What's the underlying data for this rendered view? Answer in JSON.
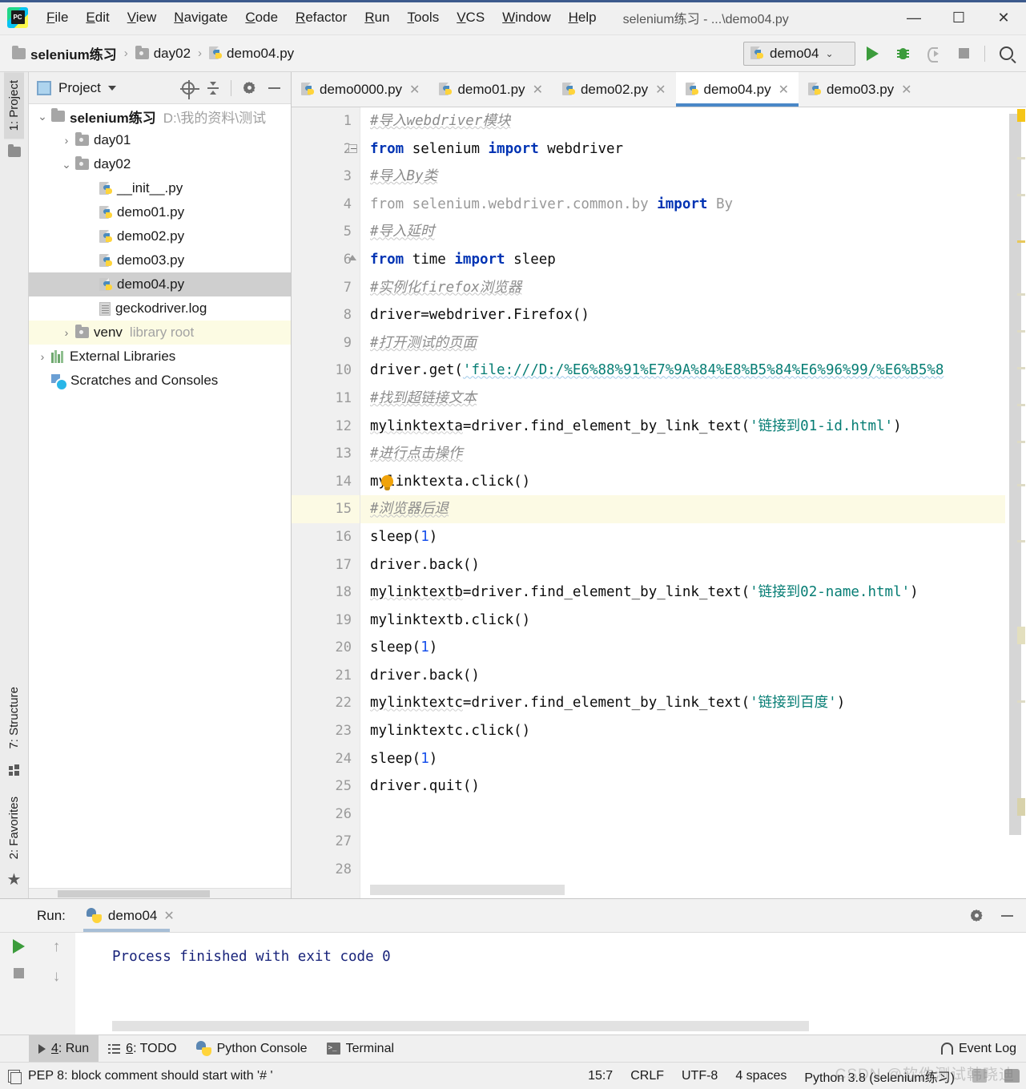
{
  "window": {
    "title": "selenium练习 - ...\\demo04.py",
    "logo_text": "PC",
    "minimize": "—",
    "maximize": "☐",
    "close": "✕"
  },
  "menu": [
    {
      "label": "File"
    },
    {
      "label": "Edit"
    },
    {
      "label": "View"
    },
    {
      "label": "Navigate"
    },
    {
      "label": "Code"
    },
    {
      "label": "Refactor"
    },
    {
      "label": "Run"
    },
    {
      "label": "Tools"
    },
    {
      "label": "VCS"
    },
    {
      "label": "Window"
    },
    {
      "label": "Help"
    }
  ],
  "breadcrumb": [
    {
      "label": "selenium练习",
      "icon": "folder-icon"
    },
    {
      "label": "day02",
      "icon": "folder-icon"
    },
    {
      "label": "demo04.py",
      "icon": "python-file-icon"
    }
  ],
  "toolbar": {
    "run_config": "demo04",
    "dropdown_caret": "⌄",
    "run_button": "run-icon",
    "debug_button": "debug-icon",
    "coverage_button": "run-with-coverage-icon",
    "stop_button": "stop-icon",
    "search_button": "search-everywhere-icon"
  },
  "rail": {
    "left_top": "1: Project",
    "left_bottom_structure": "7: Structure",
    "left_bottom_favorites": "2: Favorites"
  },
  "project_panel": {
    "title": "Project",
    "tools": [
      "select-opened-file-icon",
      "collapse-all-icon",
      "settings-icon",
      "hide-icon"
    ],
    "tree": [
      {
        "indent": 0,
        "arrow": "⌄",
        "icon": "folder-icon",
        "label": "selenium练习",
        "bold": true,
        "path": "D:\\我的资料\\测试",
        "state": "normal"
      },
      {
        "indent": 1,
        "arrow": "›",
        "icon": "folder-icon",
        "label": "day01",
        "bold": false,
        "path": "",
        "state": "normal"
      },
      {
        "indent": 1,
        "arrow": "⌄",
        "icon": "folder-icon",
        "label": "day02",
        "bold": false,
        "path": "",
        "state": "normal"
      },
      {
        "indent": 2,
        "arrow": "",
        "icon": "python-file-icon",
        "label": "__init__.py",
        "bold": false,
        "path": "",
        "state": "normal"
      },
      {
        "indent": 2,
        "arrow": "",
        "icon": "python-file-icon",
        "label": "demo01.py",
        "bold": false,
        "path": "",
        "state": "normal"
      },
      {
        "indent": 2,
        "arrow": "",
        "icon": "python-file-icon",
        "label": "demo02.py",
        "bold": false,
        "path": "",
        "state": "normal"
      },
      {
        "indent": 2,
        "arrow": "",
        "icon": "python-file-icon",
        "label": "demo03.py",
        "bold": false,
        "path": "",
        "state": "normal"
      },
      {
        "indent": 2,
        "arrow": "",
        "icon": "python-file-icon",
        "label": "demo04.py",
        "bold": false,
        "path": "",
        "state": "selected"
      },
      {
        "indent": 2,
        "arrow": "",
        "icon": "log-file-icon",
        "label": "geckodriver.log",
        "bold": false,
        "path": "",
        "state": "normal"
      },
      {
        "indent": 1,
        "arrow": "›",
        "icon": "folder-icon",
        "label": "venv",
        "bold": false,
        "path": "library root",
        "state": "highlight"
      },
      {
        "indent": 0,
        "arrow": "›",
        "icon": "external-libraries-icon",
        "label": "External Libraries",
        "bold": false,
        "path": "",
        "state": "normal"
      },
      {
        "indent": 0,
        "arrow": "",
        "icon": "scratches-icon",
        "label": "Scratches and Consoles",
        "bold": false,
        "path": "",
        "state": "normal"
      }
    ]
  },
  "editor": {
    "tabs": [
      {
        "label": "demo0000.py",
        "active": false,
        "close": "✕"
      },
      {
        "label": "demo01.py",
        "active": false,
        "close": "✕"
      },
      {
        "label": "demo02.py",
        "active": false,
        "close": "✕"
      },
      {
        "label": "demo04.py",
        "active": true,
        "close": "✕"
      },
      {
        "label": "demo03.py",
        "active": false,
        "close": "✕"
      }
    ],
    "current_line": 15,
    "lines": [
      {
        "n": 1,
        "tokens": [
          {
            "t": "#导入webdriver模块",
            "c": "cmt squig"
          }
        ]
      },
      {
        "n": 2,
        "tokens": [
          {
            "t": "from",
            "c": "kw"
          },
          {
            "t": " selenium ",
            "c": "txt"
          },
          {
            "t": "import",
            "c": "kw"
          },
          {
            "t": " webdriver",
            "c": "txt"
          }
        ],
        "fold": "open"
      },
      {
        "n": 3,
        "tokens": [
          {
            "t": "#导入By类",
            "c": "cmt squig"
          }
        ]
      },
      {
        "n": 4,
        "tokens": [
          {
            "t": "from selenium.webdriver.common.by ",
            "c": "gry"
          },
          {
            "t": "import",
            "c": "kw"
          },
          {
            "t": " By",
            "c": "gry"
          }
        ]
      },
      {
        "n": 5,
        "tokens": [
          {
            "t": "#导入延时",
            "c": "cmt squig"
          }
        ]
      },
      {
        "n": 6,
        "tokens": [
          {
            "t": "from",
            "c": "kw"
          },
          {
            "t": " time ",
            "c": "txt"
          },
          {
            "t": "import",
            "c": "kw"
          },
          {
            "t": " sleep",
            "c": "txt"
          }
        ],
        "fold": "close"
      },
      {
        "n": 7,
        "tokens": [
          {
            "t": "#实例化firefox浏览器",
            "c": "cmt squig"
          }
        ]
      },
      {
        "n": 8,
        "tokens": [
          {
            "t": "driver=webdriver.Firefox()",
            "c": "txt"
          }
        ]
      },
      {
        "n": 9,
        "tokens": [
          {
            "t": "#打开测试的页面",
            "c": "cmt squig"
          }
        ]
      },
      {
        "n": 10,
        "tokens": [
          {
            "t": "driver.get(",
            "c": "txt"
          },
          {
            "t": "'file:///D:/%E6%88%91%E7%9A%84%E8%B5%84%E6%96%99/%E6%B5%8",
            "c": "str squig-b"
          }
        ]
      },
      {
        "n": 11,
        "tokens": [
          {
            "t": "#找到超链接文本",
            "c": "cmt squig"
          }
        ]
      },
      {
        "n": 12,
        "tokens": [
          {
            "t": "mylinktexta",
            "c": "txt squig-g"
          },
          {
            "t": "=driver.find_element_by_link_text(",
            "c": "txt"
          },
          {
            "t": "'链接到01-id.html'",
            "c": "str"
          },
          {
            "t": ")",
            "c": "txt"
          }
        ]
      },
      {
        "n": 13,
        "tokens": [
          {
            "t": "#进行点击操作",
            "c": "cmt squig"
          }
        ]
      },
      {
        "n": 14,
        "tokens": [
          {
            "t": "mylinktexta.click()",
            "c": "txt"
          }
        ],
        "bulb": true
      },
      {
        "n": 15,
        "tokens": [
          {
            "t": "#浏览器后退",
            "c": "cmt squig"
          }
        ]
      },
      {
        "n": 16,
        "tokens": [
          {
            "t": "sleep(",
            "c": "txt"
          },
          {
            "t": "1",
            "c": "num"
          },
          {
            "t": ")",
            "c": "txt"
          }
        ]
      },
      {
        "n": 17,
        "tokens": [
          {
            "t": "driver.back()",
            "c": "txt"
          }
        ]
      },
      {
        "n": 18,
        "tokens": [
          {
            "t": "mylinktextb",
            "c": "txt squig-g"
          },
          {
            "t": "=driver.find_element_by_link_text(",
            "c": "txt"
          },
          {
            "t": "'链接到02-name.html'",
            "c": "str"
          },
          {
            "t": ")",
            "c": "txt"
          }
        ]
      },
      {
        "n": 19,
        "tokens": [
          {
            "t": "mylinktextb.click()",
            "c": "txt"
          }
        ]
      },
      {
        "n": 20,
        "tokens": [
          {
            "t": "sleep(",
            "c": "txt"
          },
          {
            "t": "1",
            "c": "num"
          },
          {
            "t": ")",
            "c": "txt"
          }
        ]
      },
      {
        "n": 21,
        "tokens": [
          {
            "t": "driver.back()",
            "c": "txt"
          }
        ]
      },
      {
        "n": 22,
        "tokens": [
          {
            "t": "mylinktextc",
            "c": "txt squig-g"
          },
          {
            "t": "=driver.find_element_by_link_text(",
            "c": "txt"
          },
          {
            "t": "'链接到百度'",
            "c": "str"
          },
          {
            "t": ")",
            "c": "txt"
          }
        ]
      },
      {
        "n": 23,
        "tokens": [
          {
            "t": "mylinktextc.click()",
            "c": "txt"
          }
        ]
      },
      {
        "n": 24,
        "tokens": [
          {
            "t": "sleep(",
            "c": "txt"
          },
          {
            "t": "1",
            "c": "num"
          },
          {
            "t": ")",
            "c": "txt"
          }
        ]
      },
      {
        "n": 25,
        "tokens": [
          {
            "t": "driver.quit()",
            "c": "txt"
          }
        ]
      },
      {
        "n": 26,
        "tokens": []
      },
      {
        "n": 27,
        "tokens": []
      },
      {
        "n": 28,
        "tokens": []
      }
    ]
  },
  "run_panel": {
    "label": "Run:",
    "tab": "demo04",
    "tab_close": "✕",
    "console_output": "Process finished with exit code 0",
    "rerun_icon": "rerun-icon",
    "stop_icon": "stop-icon",
    "up_icon": "↑",
    "down_icon": "↓",
    "settings_icon": "settings-icon",
    "hide_icon": "hide-icon"
  },
  "bottom_strip": {
    "items": [
      {
        "label": "4: Run",
        "underline": "4",
        "icon": "run-icon",
        "active": true
      },
      {
        "label": "6: TODO",
        "underline": "6",
        "icon": "todo-list-icon",
        "active": false
      },
      {
        "label": "Python Console",
        "underline": "",
        "icon": "python-icon",
        "active": false
      },
      {
        "label": "Terminal",
        "underline": "",
        "icon": "terminal-icon",
        "active": false
      }
    ],
    "event_log": "Event Log",
    "event_log_icon": "bell-icon"
  },
  "statusbar": {
    "message": "PEP 8: block comment should start with '# '",
    "message_icon": "inspection-icon",
    "caret_position": "15:7",
    "line_separator": "CRLF",
    "encoding": "UTF-8",
    "indent": "4 spaces",
    "interpreter": "Python 3.8 (selenium练习)",
    "icons": [
      "lock-icon",
      "hector-icon"
    ]
  },
  "watermark": "CSDN @软件测试韩晓迪",
  "colors": {
    "accent": "#4a88c7",
    "titlebar_accent": "#3c5a8c",
    "run_green": "#3c9c3c",
    "string": "#067d74",
    "keyword": "#0033b3",
    "comment": "#8c8c8c",
    "current_line": "#fcfae4",
    "selection": "#cfcfcf",
    "console_text": "#18237a"
  }
}
